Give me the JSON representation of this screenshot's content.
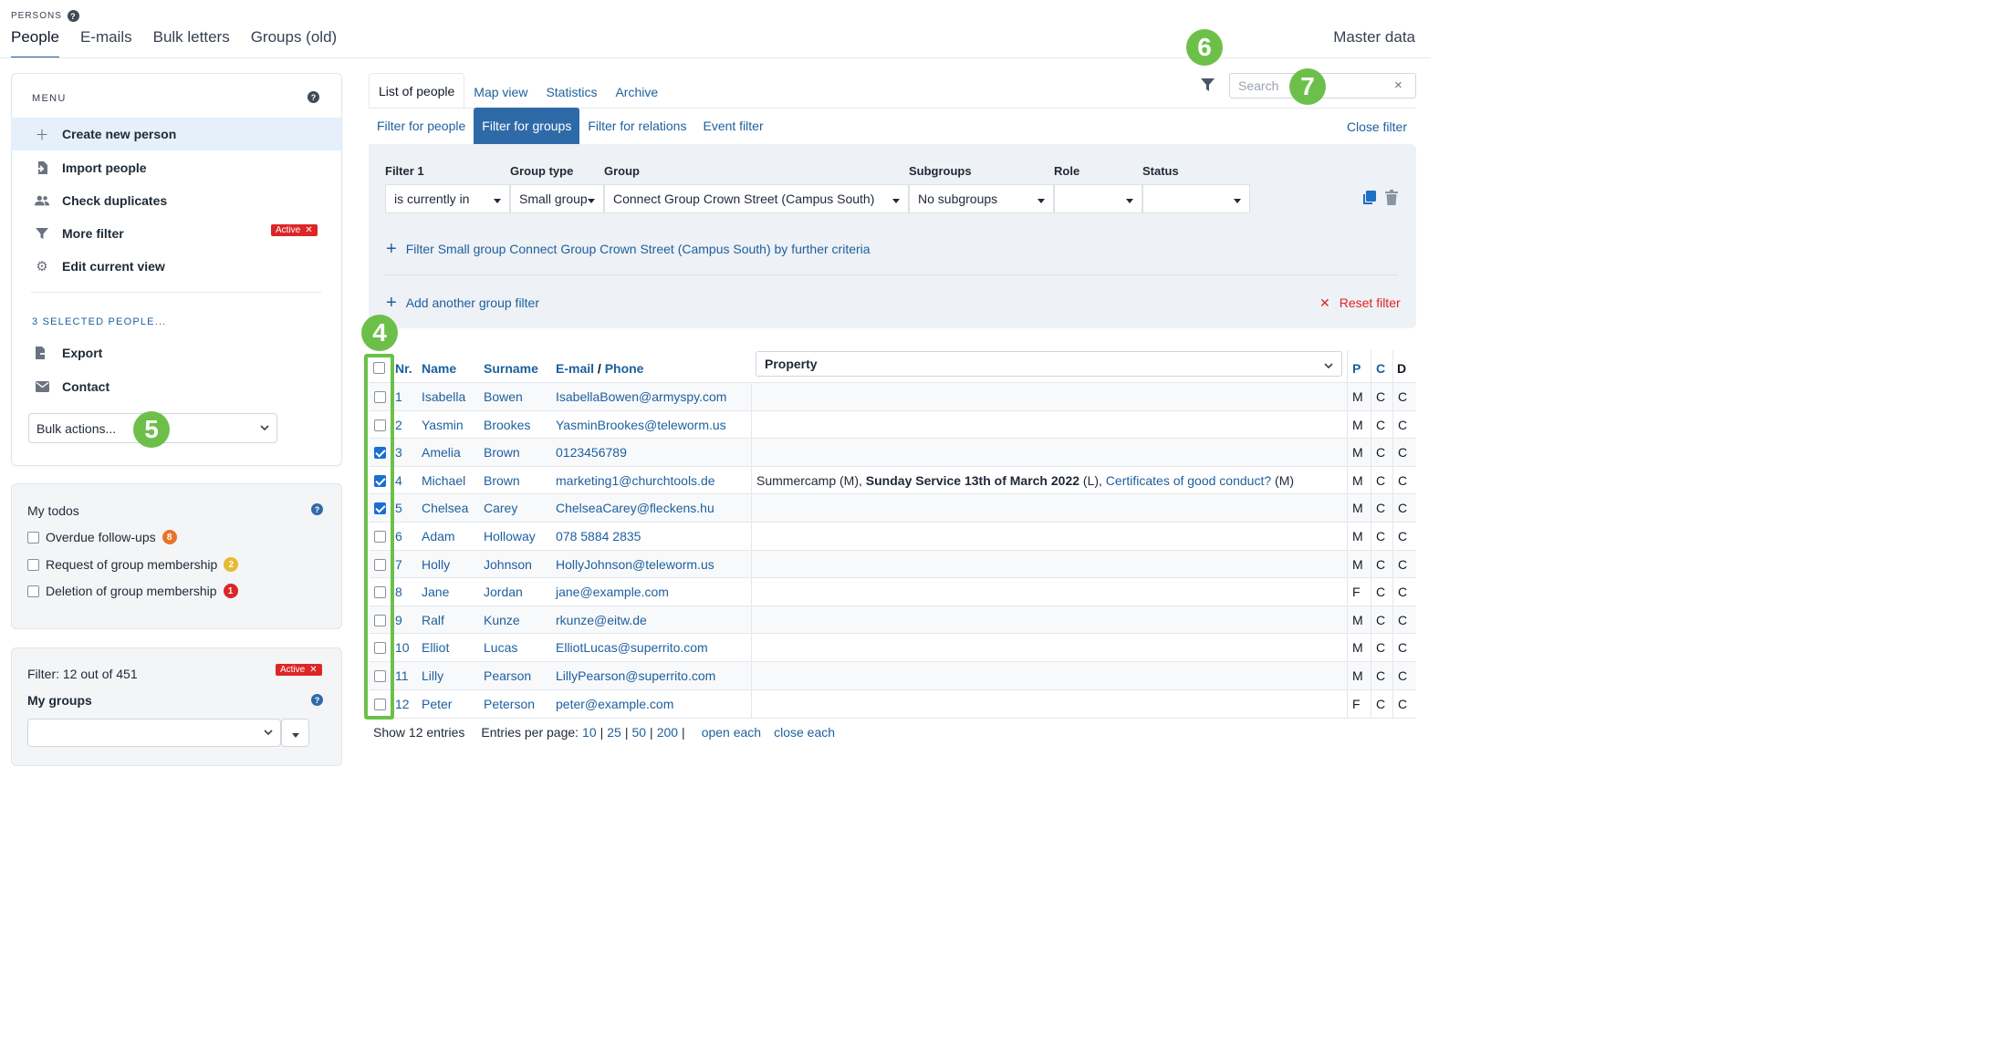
{
  "header": {
    "section_label": "PERSONS",
    "help": "?",
    "tabs": [
      {
        "label": "People"
      },
      {
        "label": "E-mails"
      },
      {
        "label": "Bulk letters"
      },
      {
        "label": "Groups (old)"
      }
    ],
    "master_data": "Master data"
  },
  "menu": {
    "title": "MENU",
    "help": "?",
    "items": [
      {
        "label": "Create new person",
        "icon": "plus-icon"
      },
      {
        "label": "Import people",
        "icon": "import-icon"
      },
      {
        "label": "Check duplicates",
        "icon": "users-icon"
      },
      {
        "label": "More filter",
        "icon": "filter-icon",
        "badge": "Active"
      },
      {
        "label": "Edit current view",
        "icon": "gear-icon"
      }
    ],
    "selected_title": "3 SELECTED PEOPLE...",
    "selected_items": [
      {
        "label": "Export",
        "icon": "export-icon"
      },
      {
        "label": "Contact",
        "icon": "envelope-icon"
      }
    ],
    "bulk_actions": "Bulk actions..."
  },
  "todos": {
    "title": "My todos",
    "help": "?",
    "items": [
      {
        "label": "Overdue follow-ups",
        "count": "8",
        "color": "#e8742c"
      },
      {
        "label": "Request of group membership",
        "count": "2",
        "color": "#e8b931"
      },
      {
        "label": "Deletion of group membership",
        "count": "1",
        "color": "#dc2626"
      }
    ]
  },
  "groups_panel": {
    "filter_text": "Filter: 12 out of 451",
    "badge": "Active",
    "title": "My groups",
    "help": "?"
  },
  "view_tabs": [
    {
      "label": "List of people"
    },
    {
      "label": "Map view"
    },
    {
      "label": "Statistics"
    },
    {
      "label": "Archive"
    }
  ],
  "search": {
    "placeholder": "Search",
    "clear": "×"
  },
  "filter_tabs": [
    {
      "label": "Filter for people"
    },
    {
      "label": "Filter for groups"
    },
    {
      "label": "Filter for relations"
    },
    {
      "label": "Event filter"
    }
  ],
  "close_filter": "Close filter",
  "filter": {
    "labels": {
      "filter": "Filter 1",
      "group_type": "Group type",
      "group": "Group",
      "subgroups": "Subgroups",
      "role": "Role",
      "status": "Status"
    },
    "values": {
      "filter": "is currently in",
      "group_type": "Small group",
      "group": "Connect Group Crown Street (Campus South)",
      "subgroups": "No subgroups",
      "role": "",
      "status": ""
    },
    "further_criteria": "Filter Small group Connect Group Crown Street (Campus South) by further criteria",
    "add_group_filter": "Add another group filter",
    "reset": "Reset filter"
  },
  "callouts": {
    "c4": "4",
    "c5": "5",
    "c6": "6",
    "c7": "7"
  },
  "table": {
    "headers": {
      "nr": "Nr.",
      "name": "Name",
      "surname": "Surname",
      "email": "E-mail",
      "slash": " / ",
      "phone": "Phone",
      "property": "Property",
      "p": "P",
      "c": "C",
      "d": "D"
    },
    "rows": [
      {
        "nr": "1",
        "name": "Isabella",
        "surname": "Bowen",
        "contact": "IsabellaBowen@armyspy.com",
        "p": "M",
        "c": "C",
        "d": "C",
        "checked": false
      },
      {
        "nr": "2",
        "name": "Yasmin",
        "surname": "Brookes",
        "contact": "YasminBrookes@teleworm.us",
        "p": "M",
        "c": "C",
        "d": "C",
        "checked": false
      },
      {
        "nr": "3",
        "name": "Amelia",
        "surname": "Brown",
        "contact": "0123456789",
        "p": "M",
        "c": "C",
        "d": "C",
        "checked": true
      },
      {
        "nr": "4",
        "name": "Michael",
        "surname": "Brown",
        "contact": "marketing1@churchtools.de",
        "p": "M",
        "c": "C",
        "d": "C",
        "checked": true,
        "property": {
          "a": "Summercamp (M), ",
          "b": "Sunday Service 13th of March 2022",
          "c": " (L), ",
          "d": "Certificates of good conduct?",
          "e": " (M)"
        }
      },
      {
        "nr": "5",
        "name": "Chelsea",
        "surname": "Carey",
        "contact": "ChelseaCarey@fleckens.hu",
        "p": "M",
        "c": "C",
        "d": "C",
        "checked": true
      },
      {
        "nr": "6",
        "name": "Adam",
        "surname": "Holloway",
        "contact": "078 5884 2835",
        "p": "M",
        "c": "C",
        "d": "C",
        "checked": false
      },
      {
        "nr": "7",
        "name": "Holly",
        "surname": "Johnson",
        "contact": "HollyJohnson@teleworm.us",
        "p": "M",
        "c": "C",
        "d": "C",
        "checked": false
      },
      {
        "nr": "8",
        "name": "Jane",
        "surname": "Jordan",
        "contact": "jane@example.com",
        "p": "F",
        "c": "C",
        "d": "C",
        "checked": false
      },
      {
        "nr": "9",
        "name": "Ralf",
        "surname": "Kunze",
        "contact": "rkunze@eitw.de",
        "p": "M",
        "c": "C",
        "d": "C",
        "checked": false
      },
      {
        "nr": "10",
        "name": "Elliot",
        "surname": "Lucas",
        "contact": "ElliotLucas@superrito.com",
        "p": "M",
        "c": "C",
        "d": "C",
        "checked": false
      },
      {
        "nr": "11",
        "name": "Lilly",
        "surname": "Pearson",
        "contact": "LillyPearson@superrito.com",
        "p": "M",
        "c": "C",
        "d": "C",
        "checked": false
      },
      {
        "nr": "12",
        "name": "Peter",
        "surname": "Peterson",
        "contact": "peter@example.com",
        "p": "F",
        "c": "C",
        "d": "C",
        "checked": false
      }
    ]
  },
  "footer": {
    "show": "Show 12 entries",
    "per_page": "Entries per page:",
    "options": [
      "10",
      "25",
      "50",
      "200"
    ],
    "sep": "|",
    "open_each": "open each",
    "close_each": "close each"
  },
  "colors": {
    "accent": "#1d5f9e",
    "active_tab": "#2f6aa8",
    "callout": "#6cc04a",
    "danger": "#dc2626"
  }
}
